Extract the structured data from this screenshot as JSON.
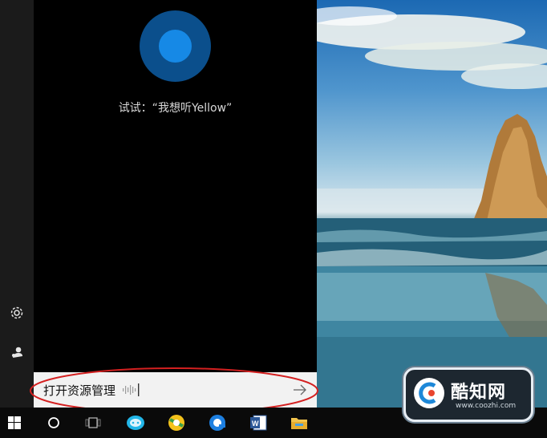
{
  "cortana": {
    "hint": "试试：“我想听Yellow”"
  },
  "search": {
    "query": "打开资源管理"
  },
  "left_rail": {
    "items": [
      "settings-icon",
      "account-icon"
    ]
  },
  "taskbar": {
    "items": [
      "windows-start-icon",
      "cortana-search-icon",
      "task-view-icon",
      "chat-app-icon",
      "browser-app-icon",
      "browser-app-icon-2",
      "word-app-icon",
      "file-explorer-icon"
    ]
  },
  "watermark": {
    "title": "酷知网",
    "url": "www.coozhi.com"
  },
  "colors": {
    "cortana_blue": "#1689e6",
    "annotation_red": "#d42020",
    "search_box": "#f2f2f2"
  }
}
